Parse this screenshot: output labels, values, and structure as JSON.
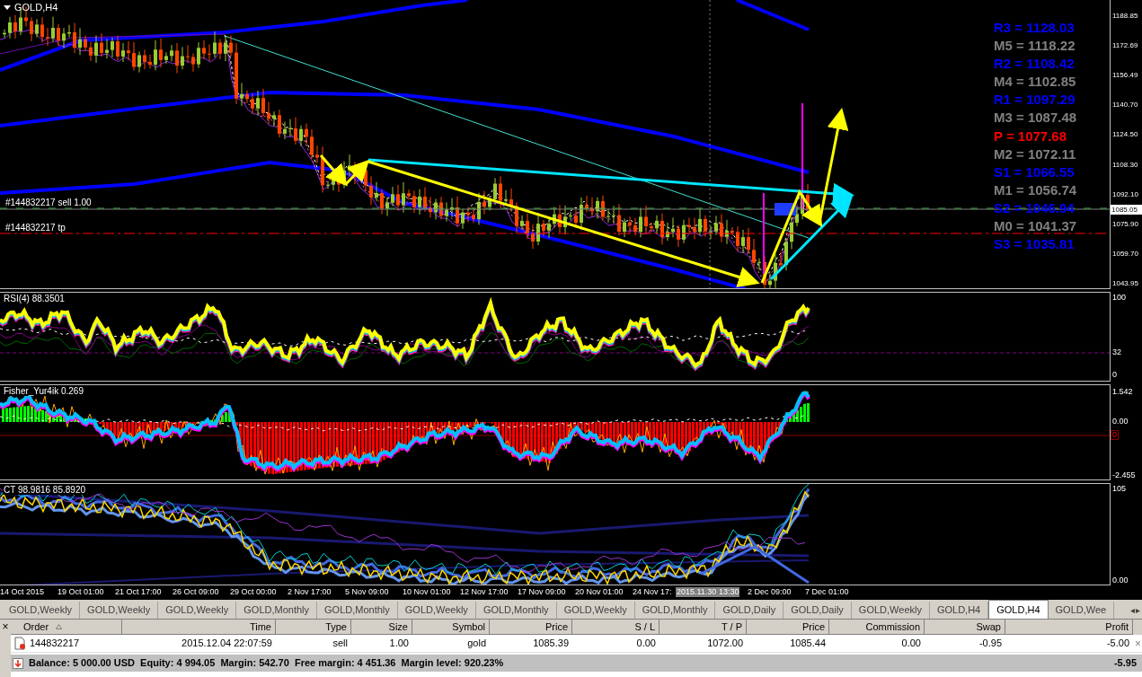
{
  "chart": {
    "title": "GOLD,H4",
    "order_label": "#144832217 sell 1.00",
    "tp_label": "#144832217 tp",
    "current_price": "1085.05",
    "price_ticks": [
      "1188.85",
      "1172.69",
      "1156.49",
      "1140.70",
      "1124.50",
      "1108.30",
      "1092.10",
      "1075.90",
      "1059.70",
      "1043.95"
    ],
    "pivots": [
      {
        "text": "R3 = 1128.03",
        "color": "#0000ff"
      },
      {
        "text": "M5 = 1118.22",
        "color": "#808080"
      },
      {
        "text": "R2 = 1108.42",
        "color": "#0000ff"
      },
      {
        "text": "M4 = 1102.85",
        "color": "#808080"
      },
      {
        "text": "R1 = 1097.29",
        "color": "#0000ff"
      },
      {
        "text": "M3 = 1087.48",
        "color": "#808080"
      },
      {
        "text": "P = 1077.68",
        "color": "#ff0000"
      },
      {
        "text": "M2 = 1072.11",
        "color": "#808080"
      },
      {
        "text": "S1 = 1066.55",
        "color": "#0000ff"
      },
      {
        "text": "M1 = 1056.74",
        "color": "#808080"
      },
      {
        "text": "S2 = 1046.94",
        "color": "#0000ff"
      },
      {
        "text": "M0 = 1041.37",
        "color": "#808080"
      },
      {
        "text": "S3 = 1035.81",
        "color": "#0000ff"
      }
    ]
  },
  "indicators": [
    {
      "title": "RSI(4) 88.3501",
      "ticks": [
        "100",
        "32",
        "0"
      ]
    },
    {
      "title": "Fisher_Yur4ik 0.269",
      "ticks": [
        "1.542",
        "0.00",
        "-2.455"
      ],
      "zero_marker": "0"
    },
    {
      "title": "CT 98.9816 85.8920",
      "ticks": [
        "105",
        "0.00"
      ]
    }
  ],
  "time_axis": [
    {
      "kind": "label",
      "text": "14 Oct 2015"
    },
    {
      "kind": "label",
      "text": "19 Oct 01:00"
    },
    {
      "kind": "label",
      "text": "21 Oct 17:00"
    },
    {
      "kind": "label",
      "text": "26 Oct 09:00"
    },
    {
      "kind": "label",
      "text": "29 Oct 00:00"
    },
    {
      "kind": "label",
      "text": "2 Nov 17:00"
    },
    {
      "kind": "label",
      "text": "5 Nov 09:00"
    },
    {
      "kind": "label",
      "text": "10 Nov 01:00"
    },
    {
      "kind": "label",
      "text": "12 Nov 17:00"
    },
    {
      "kind": "label",
      "text": "17 Nov 09:00"
    },
    {
      "kind": "label",
      "text": "20 Nov 01:00"
    },
    {
      "kind": "label",
      "text": "24 Nov 17:"
    },
    {
      "kind": "cursor",
      "text": "2015.11.30 13:30"
    },
    {
      "kind": "label",
      "text": "2 Dec 09:00"
    },
    {
      "kind": "label",
      "text": "7 Dec 01:00"
    }
  ],
  "tabs": [
    {
      "label": "GOLD,Weekly",
      "selected": false
    },
    {
      "label": "GOLD,Weekly",
      "selected": false
    },
    {
      "label": "GOLD,Weekly",
      "selected": false
    },
    {
      "label": "GOLD,Monthly",
      "selected": false
    },
    {
      "label": "GOLD,Monthly",
      "selected": false
    },
    {
      "label": "GOLD,Weekly",
      "selected": false
    },
    {
      "label": "GOLD,Monthly",
      "selected": false
    },
    {
      "label": "GOLD,Weekly",
      "selected": false
    },
    {
      "label": "GOLD,Monthly",
      "selected": false
    },
    {
      "label": "GOLD,Daily",
      "selected": false
    },
    {
      "label": "GOLD,Daily",
      "selected": false
    },
    {
      "label": "GOLD,Weekly",
      "selected": false
    },
    {
      "label": "GOLD,H4",
      "selected": false
    },
    {
      "label": "GOLD,H4",
      "selected": true
    },
    {
      "label": "GOLD,Wee",
      "selected": false
    }
  ],
  "tab_scroll": [
    "◂",
    "▸"
  ],
  "terminal": {
    "close": "×",
    "columns": [
      "Order",
      "Time",
      "Type",
      "Size",
      "Symbol",
      "Price",
      "S / L",
      "T / P",
      "Price",
      "Commission",
      "Swap",
      "Profit"
    ],
    "rows": [
      {
        "cells": [
          "144832217",
          "2015.12.04 22:07:59",
          "sell",
          "1.00",
          "gold",
          "1085.39",
          "0.00",
          "1072.00",
          "1085.44",
          "0.00",
          "-0.95",
          "-5.00"
        ],
        "close": "×"
      }
    ],
    "balance": "Balance: 5 000.00 USD  Equity: 4 994.05  Margin: 542.70  Free margin: 4 451.36  Margin level: 920.23%",
    "total_profit": "-5.95"
  }
}
